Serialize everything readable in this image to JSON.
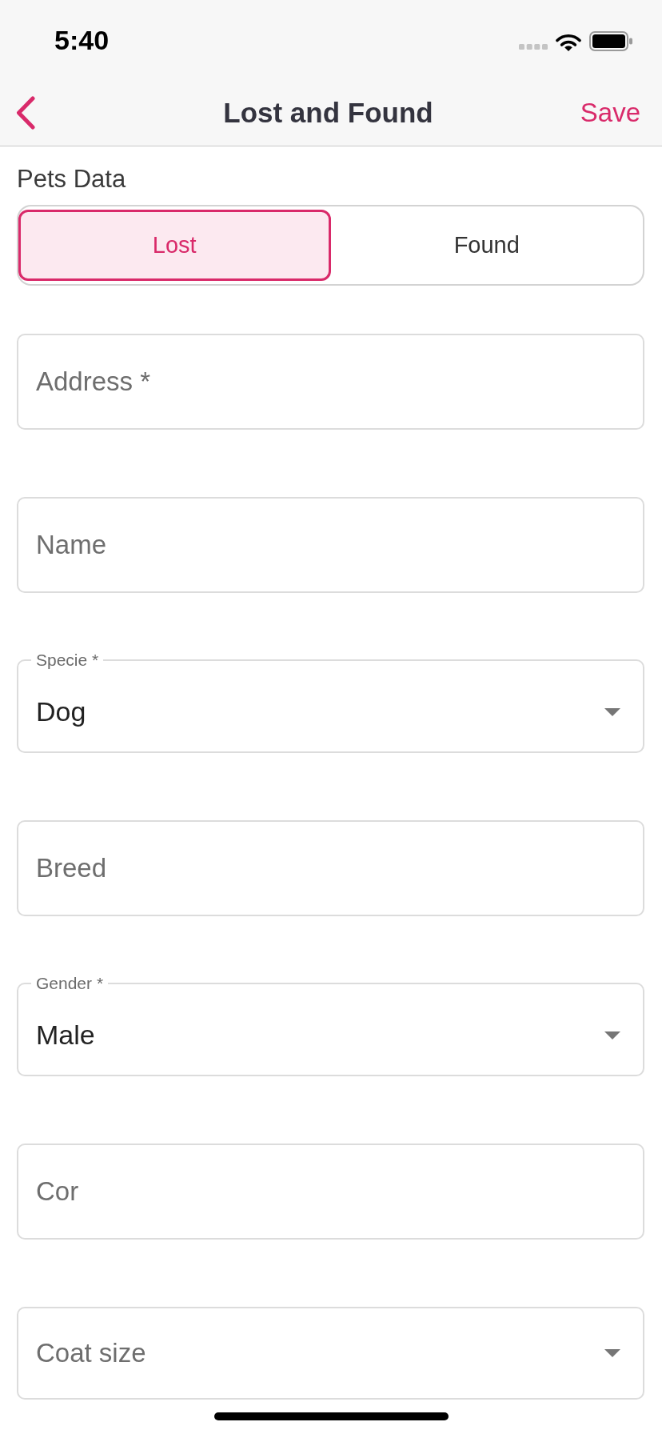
{
  "status_bar": {
    "time": "5:40"
  },
  "nav_bar": {
    "title": "Lost and Found",
    "action": "Save"
  },
  "section": {
    "title": "Pets Data"
  },
  "toggle": [
    {
      "label": "Lost",
      "selected": true
    },
    {
      "label": "Found",
      "selected": false
    }
  ],
  "fields": [
    {
      "kind": "text",
      "placeholder": "Address *"
    },
    {
      "kind": "text",
      "placeholder": "Name"
    },
    {
      "kind": "select",
      "label": "Specie *",
      "value": "Dog"
    },
    {
      "kind": "text",
      "placeholder": "Breed"
    },
    {
      "kind": "select",
      "label": "Gender *",
      "value": "Male"
    },
    {
      "kind": "text",
      "placeholder": "Cor"
    },
    {
      "kind": "select",
      "placeholder": "Coat size"
    }
  ]
}
